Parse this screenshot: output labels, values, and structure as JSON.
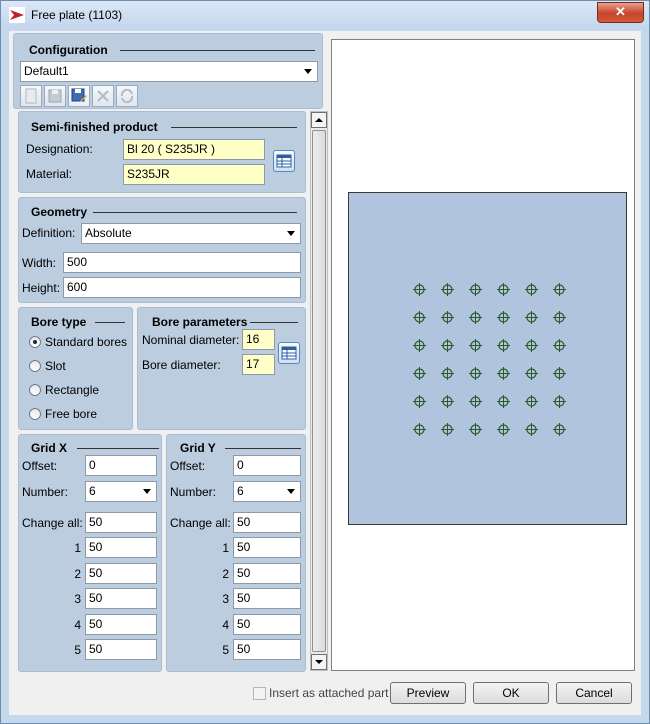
{
  "window": {
    "title": "Free plate (1103)"
  },
  "configuration": {
    "title": "Configuration",
    "selected": "Default1",
    "toolbar_icons": [
      "new-icon",
      "save-icon",
      "save-as-icon",
      "delete-icon",
      "refresh-icon"
    ]
  },
  "semi": {
    "title": "Semi-finished product",
    "designation_label": "Designation:",
    "designation_value": "Bl 20  ( S235JR )",
    "material_label": "Material:",
    "material_value": "S235JR"
  },
  "geometry": {
    "title": "Geometry",
    "definition_label": "Definition:",
    "definition_value": "Absolute",
    "width_label": "Width:",
    "width_value": "500",
    "height_label": "Height:",
    "height_value": "600"
  },
  "bore_type": {
    "title": "Bore type",
    "options": [
      "Standard bores",
      "Slot",
      "Rectangle",
      "Free bore"
    ],
    "selected_index": 0
  },
  "bore_params": {
    "title": "Bore parameters",
    "nominal_label": "Nominal diameter:",
    "nominal_value": "16",
    "bore_label": "Bore diameter:",
    "bore_value": "17"
  },
  "grid_x": {
    "title": "Grid X",
    "offset_label": "Offset:",
    "offset_value": "0",
    "number_label": "Number:",
    "number_value": "6",
    "change_all_label": "Change all:",
    "change_all_value": "50",
    "rows": [
      {
        "label": "1",
        "value": "50"
      },
      {
        "label": "2",
        "value": "50"
      },
      {
        "label": "3",
        "value": "50"
      },
      {
        "label": "4",
        "value": "50"
      },
      {
        "label": "5",
        "value": "50"
      }
    ]
  },
  "grid_y": {
    "title": "Grid Y",
    "offset_label": "Offset:",
    "offset_value": "0",
    "number_label": "Number:",
    "number_value": "6",
    "change_all_label": "Change all:",
    "change_all_value": "50",
    "rows": [
      {
        "label": "1",
        "value": "50"
      },
      {
        "label": "2",
        "value": "50"
      },
      {
        "label": "3",
        "value": "50"
      },
      {
        "label": "4",
        "value": "50"
      },
      {
        "label": "5",
        "value": "50"
      }
    ]
  },
  "footer": {
    "insert_label": "Insert as attached part",
    "insert_checked": false,
    "preview_label": "Preview",
    "ok_label": "OK",
    "cancel_label": "Cancel"
  },
  "colors": {
    "plate": "#b0c4de",
    "bore": "#2a5a2a"
  }
}
